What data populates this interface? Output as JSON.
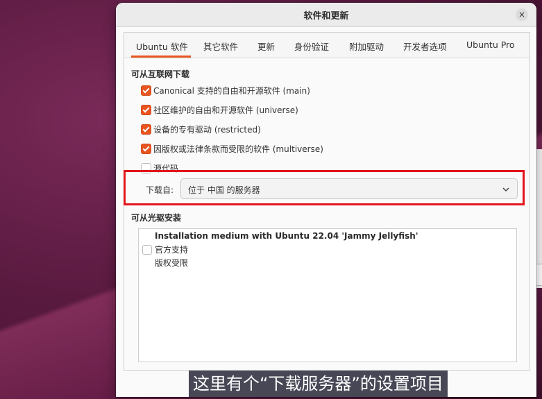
{
  "window": {
    "title": "软件和更新",
    "close_glyph": "×"
  },
  "tabs": [
    {
      "label": "Ubuntu 软件",
      "active": true
    },
    {
      "label": "其它软件",
      "active": false
    },
    {
      "label": "更新",
      "active": false
    },
    {
      "label": "身份验证",
      "active": false
    },
    {
      "label": "附加驱动",
      "active": false
    },
    {
      "label": "开发者选项",
      "active": false
    },
    {
      "label": "Ubuntu Pro",
      "active": false
    }
  ],
  "internet_section": {
    "title": "可从互联网下载",
    "options": [
      {
        "label": "Canonical 支持的自由和开源软件 (main)",
        "checked": true
      },
      {
        "label": "社区维护的自由和开源软件 (universe)",
        "checked": true
      },
      {
        "label": "设备的专有驱动 (restricted)",
        "checked": true
      },
      {
        "label": "因版权或法律条款而受限的软件 (multiverse)",
        "checked": true
      },
      {
        "label": "源代码",
        "checked": false
      }
    ],
    "download_from_label": "下载自:",
    "download_from_value": "位于 中国 的服务器"
  },
  "cdrom_section": {
    "title": "可从光驱安装",
    "media": {
      "title": "Installation medium with Ubuntu 22.04 'Jammy Jellyfish'",
      "line1": "官方支持",
      "line2": "版权受限",
      "checked": false
    }
  },
  "caption": "这里有个“下载服务器”的设置项目",
  "colors": {
    "accent": "#e95420",
    "highlight_border": "#e3141b"
  },
  "icons": {
    "close": "close-icon",
    "dropdown": "chevron-down-icon",
    "cursor": "mouse-pointer-icon"
  }
}
